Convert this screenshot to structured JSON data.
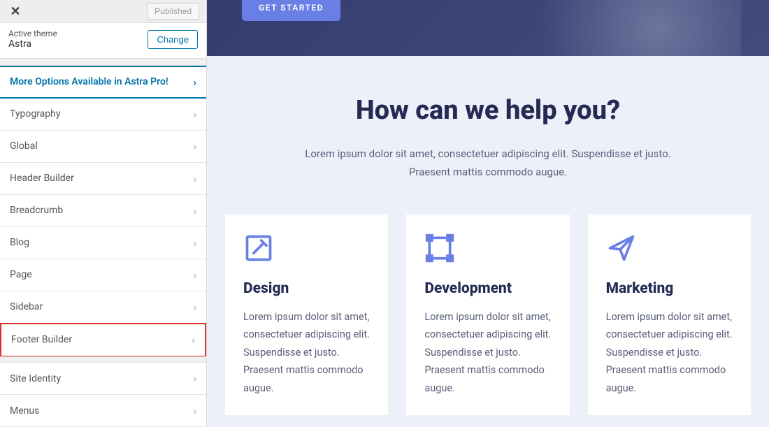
{
  "header": {
    "published_label": "Published"
  },
  "theme": {
    "label": "Active theme",
    "name": "Astra",
    "change_label": "Change"
  },
  "promo": {
    "label": "More Options Available in Astra Pro!"
  },
  "nav": {
    "items": [
      {
        "label": "Typography"
      },
      {
        "label": "Global"
      },
      {
        "label": "Header Builder"
      },
      {
        "label": "Breadcrumb"
      },
      {
        "label": "Blog"
      },
      {
        "label": "Page"
      },
      {
        "label": "Sidebar"
      },
      {
        "label": "Footer Builder"
      }
    ],
    "section2": [
      {
        "label": "Site Identity"
      },
      {
        "label": "Menus"
      }
    ]
  },
  "preview": {
    "cta": "GET STARTED",
    "title": "How can we help you?",
    "subtitle": "Lorem ipsum dolor sit amet, consectetuer adipiscing elit. Suspendisse et justo. Praesent mattis commodo augue.",
    "cards": [
      {
        "title": "Design",
        "text": "Lorem ipsum dolor sit amet, consectetuer adipiscing elit. Suspendisse et justo. Praesent mattis commodo augue."
      },
      {
        "title": "Development",
        "text": "Lorem ipsum dolor sit amet, consectetuer adipiscing elit. Suspendisse et justo. Praesent mattis commodo augue."
      },
      {
        "title": "Marketing",
        "text": "Lorem ipsum dolor sit amet, consectetuer adipiscing elit. Suspendisse et justo. Praesent mattis commodo augue."
      }
    ]
  }
}
